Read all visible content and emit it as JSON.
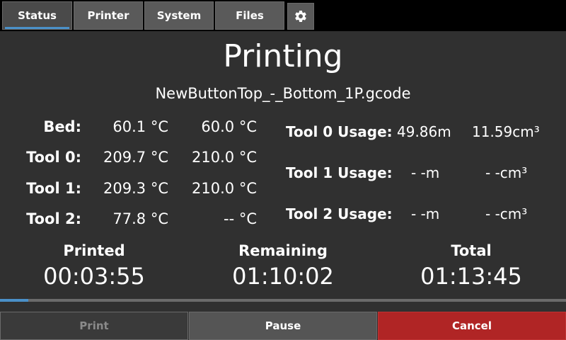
{
  "tabs": [
    {
      "label": "Status",
      "active": true
    },
    {
      "label": "Printer",
      "active": false
    },
    {
      "label": "System",
      "active": false
    },
    {
      "label": "Files",
      "active": false
    }
  ],
  "settings_icon": "gear-icon",
  "status": {
    "title": "Printing",
    "filename": "NewButtonTop_-_Bottom_1P.gcode"
  },
  "temps": [
    {
      "label": "Bed:",
      "current": "60.1 °C",
      "target": "60.0 °C"
    },
    {
      "label": "Tool 0:",
      "current": "209.7 °C",
      "target": "210.0 °C"
    },
    {
      "label": "Tool 1:",
      "current": "209.3 °C",
      "target": "210.0 °C"
    },
    {
      "label": "Tool 2:",
      "current": "77.8 °C",
      "target": "-- °C"
    }
  ],
  "usage": [
    {
      "label": "Tool 0 Usage:",
      "length": "49.86m",
      "volume": "11.59cm³"
    },
    {
      "label": "Tool 1 Usage:",
      "length": "- -m",
      "volume": "- -cm³"
    },
    {
      "label": "Tool 2 Usage:",
      "length": "- -m",
      "volume": "- -cm³"
    }
  ],
  "times": {
    "printed_label": "Printed",
    "printed": "00:03:55",
    "remaining_label": "Remaining",
    "remaining": "01:10:02",
    "total_label": "Total",
    "total": "01:13:45"
  },
  "progress": 0.05,
  "colors": {
    "accent": "#4a90c8",
    "cancel": "#b02525"
  },
  "buttons": {
    "print": "Print",
    "pause": "Pause",
    "cancel": "Cancel"
  }
}
